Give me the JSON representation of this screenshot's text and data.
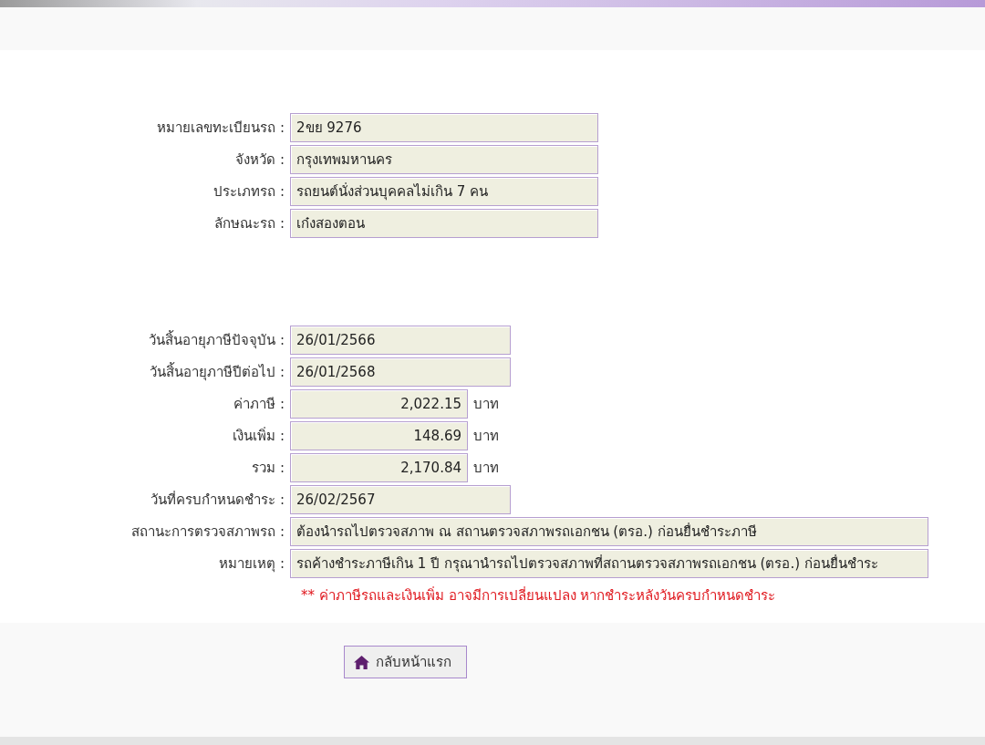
{
  "vehicle": [
    {
      "label": "หมายเลขทะเบียนรถ :",
      "value": "2ขย 9276",
      "kind": "medium"
    },
    {
      "label": "จังหวัด :",
      "value": "กรุงเทพมหานคร",
      "kind": "medium"
    },
    {
      "label": "ประเภทรถ :",
      "value": "รถยนต์นั่งส่วนบุคคลไม่เกิน 7 คน",
      "kind": "medium"
    },
    {
      "label": "ลักษณะรถ :",
      "value": "เก๋งสองตอน",
      "kind": "medium"
    }
  ],
  "tax": [
    {
      "label": "วันสิ้นอายุภาษีปัจจุบัน :",
      "value": "26/01/2566",
      "kind": "date"
    },
    {
      "label": "วันสิ้นอายุภาษีปีต่อไป :",
      "value": "26/01/2568",
      "kind": "date"
    },
    {
      "label": "ค่าภาษี :",
      "value": "2,022.15",
      "kind": "amount",
      "unit": "บาท"
    },
    {
      "label": "เงินเพิ่ม :",
      "value": "148.69",
      "kind": "amount",
      "unit": "บาท"
    },
    {
      "label": "รวม :",
      "value": "2,170.84",
      "kind": "amount",
      "unit": "บาท"
    },
    {
      "label": "วันที่ครบกำหนดชำระ :",
      "value": "26/02/2567",
      "kind": "date"
    },
    {
      "label": "สถานะการตรวจสภาพรถ :",
      "value": "ต้องนำรถไปตรวจสภาพ ณ สถานตรวจสภาพรถเอกชน (ตรอ.) ก่อนยื่นชำระภาษี",
      "kind": "long"
    },
    {
      "label": "หมายเหตุ :",
      "value": "รถค้างชำระภาษีเกิน 1 ปี กรุณานำรถไปตรวจสภาพที่สถานตรวจสภาพรถเอกชน (ตรอ.) ก่อนยื่นชำระ",
      "kind": "long"
    }
  ],
  "warning": "** ค่าภาษีรถและเงินเพิ่ม อาจมีการเปลี่ยนแปลง หากชำระหลังวันครบกำหนดชำระ",
  "home_button": "กลับหน้าแรก"
}
